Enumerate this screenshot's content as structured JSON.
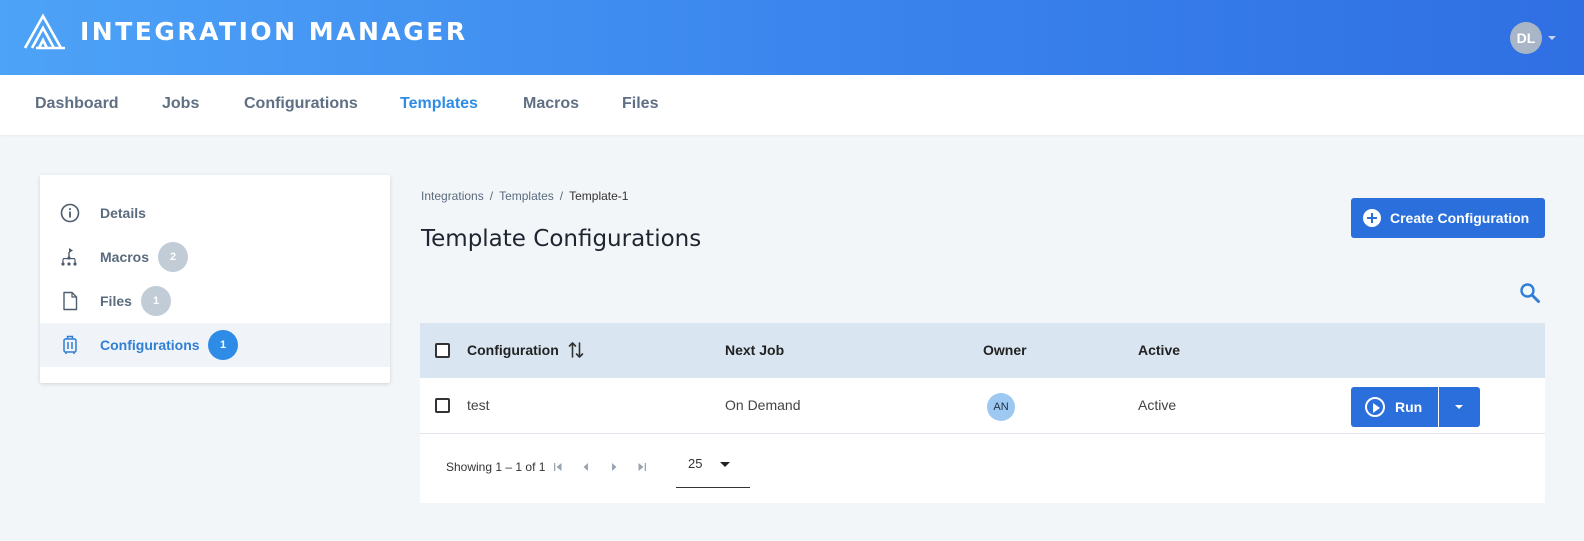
{
  "app": {
    "title": "INTEGRATION MANAGER",
    "user_initials": "DL"
  },
  "nav": {
    "items": [
      {
        "label": "Dashboard",
        "active": false
      },
      {
        "label": "Jobs",
        "active": false
      },
      {
        "label": "Configurations",
        "active": false
      },
      {
        "label": "Templates",
        "active": true
      },
      {
        "label": "Macros",
        "active": false
      },
      {
        "label": "Files",
        "active": false
      }
    ]
  },
  "sidebar": {
    "items": [
      {
        "label": "Details",
        "icon": "info-icon",
        "badge": null,
        "active": false
      },
      {
        "label": "Macros",
        "icon": "macro-tree-icon",
        "badge": "2",
        "active": false
      },
      {
        "label": "Files",
        "icon": "file-icon",
        "badge": "1",
        "active": false
      },
      {
        "label": "Configurations",
        "icon": "configurations-icon",
        "badge": "1",
        "active": true
      }
    ]
  },
  "breadcrumb": {
    "items": [
      "Integrations",
      "Templates"
    ],
    "separator": "/",
    "current": "Template-1"
  },
  "page": {
    "title": "Template Configurations"
  },
  "actions": {
    "create_label": "Create Configuration",
    "search_icon": "search-icon"
  },
  "table": {
    "columns": [
      "Configuration",
      "Next Job",
      "Owner",
      "Active"
    ],
    "rows": [
      {
        "configuration": "test",
        "next_job": "On Demand",
        "owner": "AN",
        "active": "Active",
        "run_label": "Run"
      }
    ]
  },
  "pagination": {
    "showing": "Showing 1 – 1 of 1",
    "page_size": "25"
  },
  "colors": {
    "accent": "#2a6fdb",
    "nav_active": "#2f8ce6",
    "header_gradient_start": "#4da3f7",
    "header_gradient_end": "#2f6fe3"
  }
}
